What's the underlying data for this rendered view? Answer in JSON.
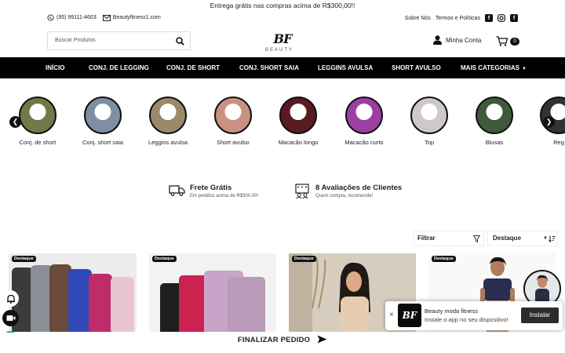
{
  "promo": {
    "text": "Entrega grátis nas compras acima de R$300,00!!"
  },
  "header": {
    "phone": "(95) 99111-4603",
    "instagram_handle": "Beautyfitness1.com",
    "links": [
      "Sobre Nós",
      "Termos e Políticas"
    ],
    "search_placeholder": "Buscar Produtos",
    "logo_text": "BF",
    "logo_wordmark": "BEAUTY",
    "account_label": "Minha Conta",
    "cart_count": "0"
  },
  "nav": {
    "items": [
      "INÍCIO",
      "CONJ. DE LEGGING",
      "CONJ. DE SHORT",
      "CONJ. SHORT SAIA",
      "LEGGINS AVULSA",
      "SHORT AVULSO",
      "MAIS CATEGORIAS"
    ]
  },
  "categories": [
    {
      "label": "Conj. de short",
      "color": "#6f7a4a"
    },
    {
      "label": "Conj. short saia",
      "color": "#7e8ea3"
    },
    {
      "label": "Leggins avulsa",
      "color": "#9a8a6a"
    },
    {
      "label": "Short avulso",
      "color": "#c99280"
    },
    {
      "label": "Macacão longo",
      "color": "#5a1a22"
    },
    {
      "label": "Macacão curto",
      "color": "#9b3fa0"
    },
    {
      "label": "Top",
      "color": "#cfc8c8"
    },
    {
      "label": "Blusas",
      "color": "#3f5a3a"
    },
    {
      "label": "Reg",
      "color": "#333333"
    }
  ],
  "benefits": [
    {
      "title": "Frete Grátis",
      "subtitle": "Em pedidos acima de R$300,00!"
    },
    {
      "title": "8 Avaliações de Clientes",
      "subtitle": "Quem compra, recomenda!"
    }
  ],
  "listing": {
    "filter_label": "Filtrar",
    "sort_label": "Destaque"
  },
  "products": [
    {
      "tag": "Destaque"
    },
    {
      "tag": "Destaque"
    },
    {
      "tag": "Destaque"
    },
    {
      "tag": "Destaque"
    }
  ],
  "pwa_banner": {
    "title": "Beauty moda fitness",
    "subtitle": "Instale o app no seu dispositivo!",
    "button": "Instalar"
  },
  "footer_bar": {
    "label": "FINALIZAR PEDIDO"
  }
}
